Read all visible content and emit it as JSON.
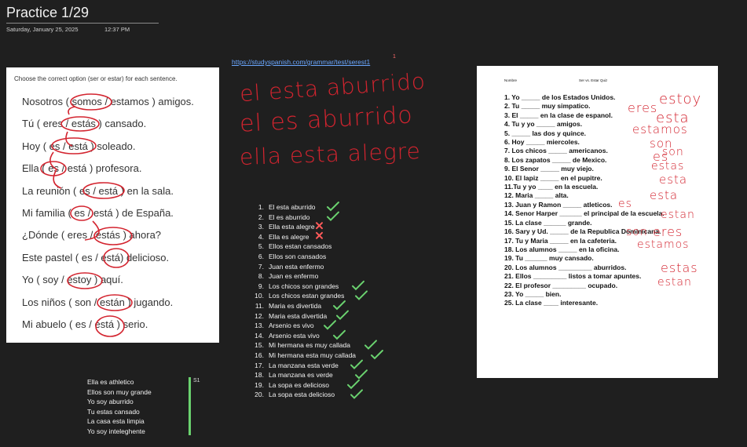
{
  "page": {
    "title": "Practice 1/29",
    "date": "Saturday, January 25, 2025",
    "time": "12:37 PM"
  },
  "link": {
    "url": "https://studyspanish.com/grammar/test/serest1",
    "superscript": "1"
  },
  "left_card": {
    "instruction": "Choose the correct option (ser or estar) for each sentence.",
    "sentences": [
      "Nosotros ( somos / estamos ) amigos.",
      "Tú ( eres / estás ) cansado.",
      "Hoy ( es / está ) soleado.",
      "Ella ( es / está ) profesora.",
      "La reunión ( es / está ) en la sala.",
      "Mi familia ( es / está ) de España.",
      "¿Dónde ( eres / estás ) ahora?",
      "Este pastel ( es / está) delicioso.",
      "Yo ( soy / estoy ) aquí.",
      "Los niños ( son / están ) jugando.",
      "Mi abuelo ( es / está ) serio."
    ]
  },
  "handwriting": {
    "line1": "el esta aburrido",
    "line2": "el es aburrido",
    "line3": "ella esta alegre"
  },
  "numbered_list": [
    "El esta aburrido",
    "El es aburrido",
    "Ella esta alegre",
    "Ella es alegre",
    "Ellos estan cansados",
    "Ellos son cansados",
    "Juan esta enfermo",
    "Juan es enfermo",
    "Los chicos son grandes",
    "Los chicos estan grandes",
    "Maria es divertida",
    "Maria esta divertida",
    "Arsenio es vivo",
    "Arsenio esta vivo",
    "Mi hermana es muy callada",
    "Mi hermana esta muy callada",
    "La manzana esta verde",
    "La manzana es verde",
    "La sopa es delicioso",
    "La sopa esta delicioso"
  ],
  "numbered_marks": [
    "check",
    "check",
    "x",
    "x",
    "",
    "",
    "",
    "",
    "check",
    "check",
    "check",
    "check",
    "check",
    "check",
    "check",
    "check",
    "check",
    "check",
    "check",
    "check"
  ],
  "small_list": {
    "label": "S1",
    "items": [
      "Ella es athletico",
      "Ellos son muy grande",
      "Yo soy aburrido",
      "Tu estas cansado",
      "La casa esta limpia",
      "Yo soy inteleghente"
    ]
  },
  "quiz": {
    "header_left": "Nombre",
    "header_right": "Ser vs. Estar Quiz",
    "items": [
      "1.  Yo _____ de los Estados Unidos.",
      "2.  Tu _____ muy simpatico.",
      "3.  El _____ en la clase de espanol.",
      "4.  Tu y yo _____ amigos.",
      "5.  _____ las dos y quince.",
      "6.  Hoy _____ miercoles.",
      "7.  Los chicos _____ americanos.",
      "8.  Los zapatos _____ de Mexico.",
      "9.  El Senor _____ muy viejo.",
      "10. El lapiz _____ en el pupitre.",
      "11.Tu y yo ____ en la escuela.",
      "12.  Maria _____ alta.",
      "13.  Juan y Ramon _____ atleticos.",
      "14.  Senor Harper ______ el principal de la escuela.",
      "15.  La clase ______ grande.",
      "16.  Sary y Ud. _____ de la Republica Dominicana.",
      "17.  Tu y Maria _____ en la cafeteria.",
      "18.  Los alumnos _____ en la oficina.",
      "19.  Tu ______ muy cansado.",
      "20.  Los alumnos _________ aburridos.",
      "21.  Ellos _________ listos a tomar apuntes.",
      "22.  El profesor _________ ocupado.",
      "23.  Yo _____ bien.",
      "25.  La clase ____ interesante."
    ],
    "answers": [
      "estoy",
      "eres",
      "esta",
      "estamos",
      "son",
      "es",
      "son",
      "estas",
      "esta",
      "esta",
      "es",
      "estan",
      "son",
      "eres",
      "estamos",
      "estas",
      "estan"
    ]
  },
  "colors": {
    "background": "#1f1f1f",
    "ink_red": "#d3242f",
    "check_green": "#6ad26f",
    "x_red": "#ff5a5a",
    "link_blue": "#6aa7ff"
  }
}
